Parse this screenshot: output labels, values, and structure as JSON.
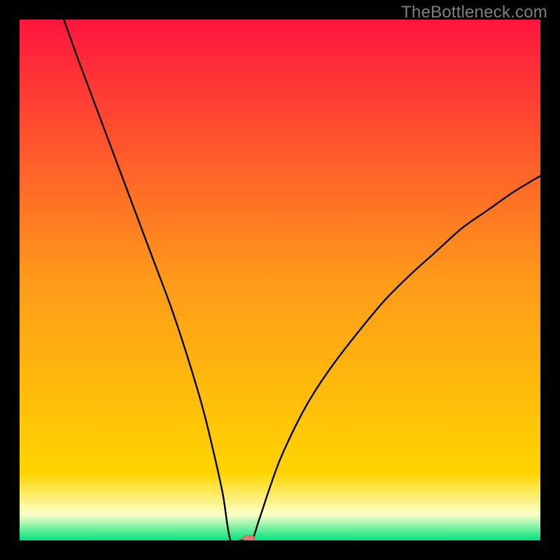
{
  "watermark": "TheBottleneck.com",
  "colors": {
    "frame": "#000000",
    "grad_top": "#ff163f",
    "grad_mid": "#ffd400",
    "grad_pale": "#fbffc8",
    "grad_green": "#00e37e",
    "curve": "#000000",
    "marker_fill": "#e07a6c",
    "marker_stroke": "#c96a5d"
  },
  "chart_data": {
    "type": "line",
    "title": "",
    "xlabel": "",
    "ylabel": "",
    "xlim": [
      0,
      100
    ],
    "ylim": [
      0,
      100
    ],
    "minimum": {
      "x": 43,
      "y": 0
    },
    "marker": {
      "x": 44,
      "y": 0,
      "rx": 1.2,
      "ry": 0.55
    },
    "left_branch_top": {
      "x": 8.5,
      "y": 100
    },
    "right_branch_top": {
      "x": 100,
      "y": 70
    },
    "flat_segment": {
      "x0": 40.5,
      "x1": 44.5,
      "y": 0
    },
    "series": [
      {
        "name": "bottleneck-curve",
        "points": [
          {
            "x": 8.5,
            "y": 100.0
          },
          {
            "x": 11.0,
            "y": 93.0
          },
          {
            "x": 14.0,
            "y": 85.0
          },
          {
            "x": 17.0,
            "y": 77.0
          },
          {
            "x": 20.0,
            "y": 69.0
          },
          {
            "x": 23.0,
            "y": 61.0
          },
          {
            "x": 26.0,
            "y": 53.0
          },
          {
            "x": 29.0,
            "y": 45.0
          },
          {
            "x": 32.0,
            "y": 36.0
          },
          {
            "x": 35.0,
            "y": 26.0
          },
          {
            "x": 37.0,
            "y": 18.0
          },
          {
            "x": 39.0,
            "y": 9.0
          },
          {
            "x": 40.5,
            "y": 0.0
          },
          {
            "x": 42.5,
            "y": 0.0
          },
          {
            "x": 44.5,
            "y": 0.0
          },
          {
            "x": 46.0,
            "y": 4.0
          },
          {
            "x": 48.0,
            "y": 10.0
          },
          {
            "x": 50.0,
            "y": 15.5
          },
          {
            "x": 53.0,
            "y": 22.0
          },
          {
            "x": 56.0,
            "y": 27.5
          },
          {
            "x": 60.0,
            "y": 33.5
          },
          {
            "x": 65.0,
            "y": 40.0
          },
          {
            "x": 70.0,
            "y": 46.0
          },
          {
            "x": 75.0,
            "y": 51.0
          },
          {
            "x": 80.0,
            "y": 55.5
          },
          {
            "x": 85.0,
            "y": 60.0
          },
          {
            "x": 90.0,
            "y": 63.5
          },
          {
            "x": 95.0,
            "y": 67.0
          },
          {
            "x": 100.0,
            "y": 70.0
          }
        ]
      }
    ]
  }
}
